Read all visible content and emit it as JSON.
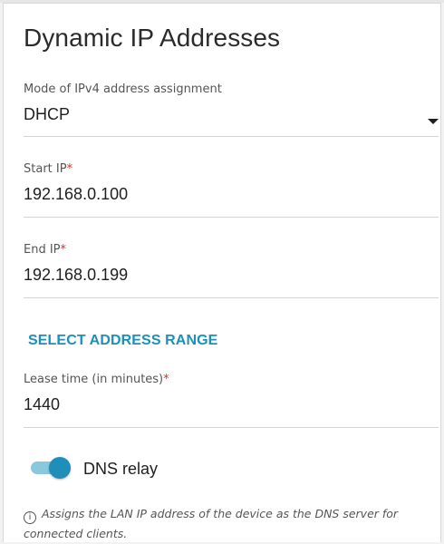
{
  "section": {
    "title": "Dynamic IP Addresses"
  },
  "mode": {
    "label": "Mode of IPv4 address assignment",
    "value": "DHCP"
  },
  "start_ip": {
    "label": "Start IP",
    "required_mark": "*",
    "value": "192.168.0.100"
  },
  "end_ip": {
    "label": "End IP",
    "required_mark": "*",
    "value": "192.168.0.199"
  },
  "address_range": {
    "link_label": "SELECT ADDRESS RANGE"
  },
  "lease_time": {
    "label": "Lease time (in minutes)",
    "required_mark": "*",
    "value": "1440"
  },
  "dns_relay": {
    "label": "DNS relay",
    "enabled": true,
    "hint_icon": "i",
    "hint": "Assigns the LAN IP address of the device as the DNS server for connected clients."
  },
  "colors": {
    "accent": "#1d8fb8",
    "required": "#d8321c",
    "toggle_track": "#8cc8dd"
  },
  "icons": {
    "dropdown": "caret-down-icon",
    "info": "info-icon"
  }
}
